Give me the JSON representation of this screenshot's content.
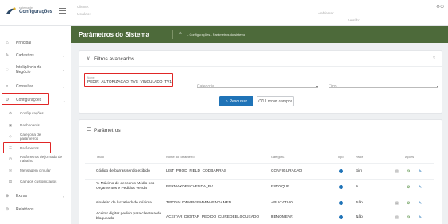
{
  "header": {
    "logo_small": "sistema de",
    "logo_title": "Configurações",
    "cliente_label": "Cliente:",
    "usuario_label": "Usuário:",
    "ambiente_label": "Ambiente:",
    "versao_label": "Versão:",
    "right_icons": "⚙⏻"
  },
  "sidebar": {
    "items": [
      {
        "label": "Principal",
        "icon": "home-icon"
      },
      {
        "label": "Cadastros",
        "icon": "edit-icon"
      },
      {
        "label": "Inteligência de Negócio",
        "icon": "bulb-icon"
      },
      {
        "label": "Consultas",
        "icon": "search-icon"
      },
      {
        "label": "Configurações",
        "icon": "gear-icon"
      },
      {
        "label": "Extras",
        "icon": "plus-icon"
      },
      {
        "label": "Relatórios",
        "icon": "report-icon"
      }
    ],
    "sub_items": [
      {
        "label": "Configurações"
      },
      {
        "label": "Dashboards"
      },
      {
        "label": "Categoria de parâmetros"
      },
      {
        "label": "Parâmetros"
      },
      {
        "label": "Parâmetros de jornada de trabalho"
      },
      {
        "label": "Mensagem circular"
      },
      {
        "label": "Campos customizados"
      }
    ],
    "chevron": "›"
  },
  "titlebar": {
    "title": "Parâmetros do Sistema",
    "home_icon": "⌂",
    "breadcrumb": "- Configurações - Parâmetros do sistema"
  },
  "filters": {
    "title": "Filtros avançados",
    "collapse_icon": "≈",
    "nome": {
      "label": "Nome",
      "value": "PEDIR_AUTORIZACAO_TVS_VINCULADO_TV1"
    },
    "categoria": {
      "placeholder": "Categoria"
    },
    "tipo": {
      "placeholder": "Tipo"
    },
    "search_button": "Pesquisar",
    "clear_button": "Limpar campos",
    "caret": "▾"
  },
  "table": {
    "title": "Parâmetros",
    "columns": [
      "Título",
      "Nome do parâmetro",
      "Categoria",
      "Tipo",
      "Valor",
      "Ações"
    ],
    "rows": [
      {
        "titulo": "Código de barras sendo exibido",
        "nome": "LIST_PROD_FIELD_CODBARRAS",
        "categoria": "CONFIGURACAO",
        "valor": "Sim"
      },
      {
        "titulo": "% Máximo de desconto Médio nos Orçamentos e Pedidos Venda",
        "nome": "PERMAXDESCVENDA_FV",
        "categoria": "ESTOQUE",
        "valor": "0"
      },
      {
        "titulo": "sinaleiro de lucratividade mínima",
        "nome": "TIPOVALIDMARGEMMINVENDAMED",
        "categoria": "APLICATIVO",
        "valor": "Não"
      },
      {
        "titulo": "Aceitar digitar pedido para cliente rede bloqueado",
        "nome": "ACEITAR_DIGITAR_PEDIDO_CLIREDEBLOQUEADO",
        "categoria": "RENOMEAR",
        "valor": "Não"
      }
    ]
  }
}
